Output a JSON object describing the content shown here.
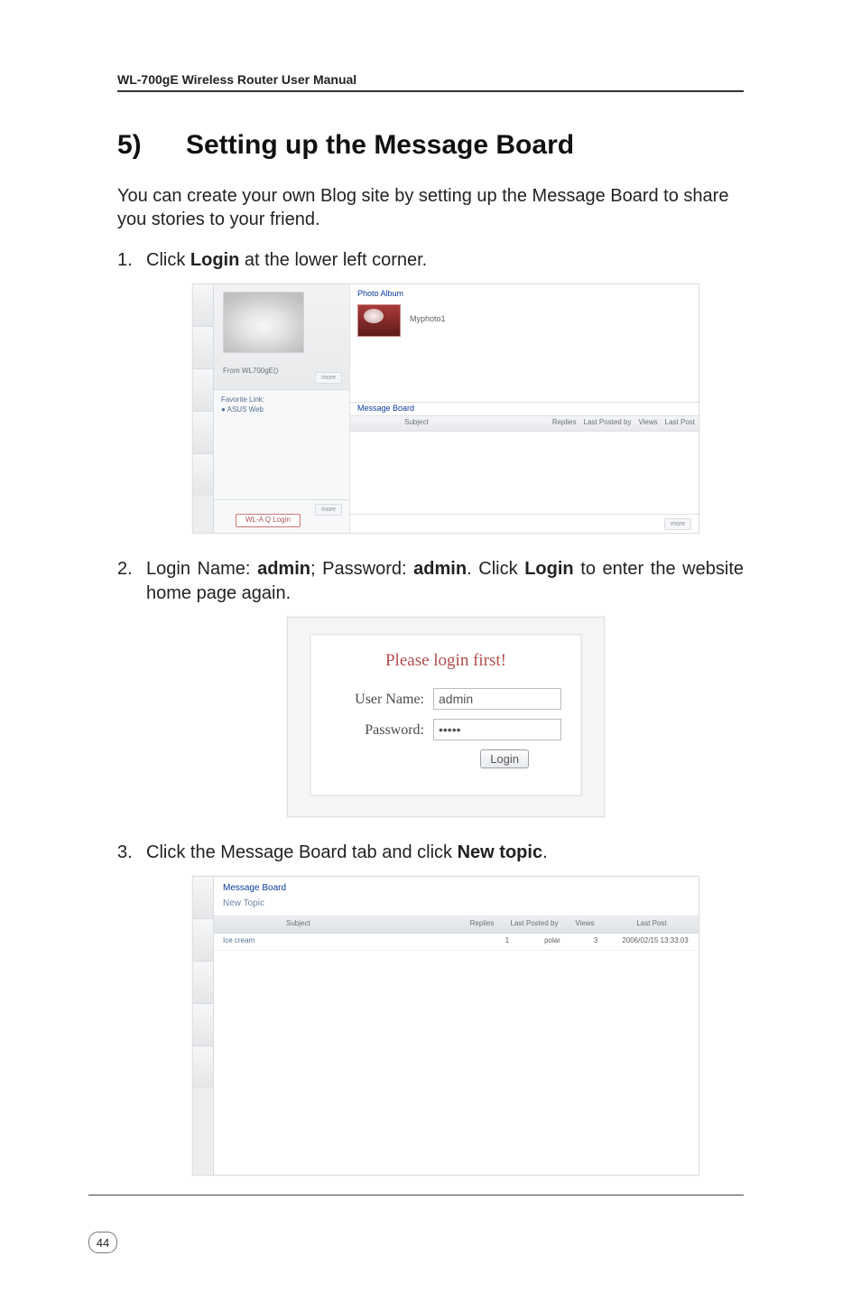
{
  "doc": {
    "running_head": "WL-700gE Wireless Router User Manual",
    "section_number": "5)",
    "section_title": "Setting up the Message Board",
    "intro": "You can create your own Blog site by setting up the Message Board to share you stories to your friend.",
    "page_number": "44"
  },
  "steps": {
    "s1_marker": "1.",
    "s1_a": "Click ",
    "s1_b": "Login",
    "s1_c": " at the lower left corner.",
    "s2_marker": "2.",
    "s2_a": "Login Name: ",
    "s2_b": "admin",
    "s2_c": "; Password: ",
    "s2_d": "admin",
    "s2_e": ". Click ",
    "s2_f": "Login",
    "s2_g": " to enter the website home page again.",
    "s3_marker": "3.",
    "s3_a": "Click the Message Board tab and click ",
    "s3_b": "New topic",
    "s3_c": "."
  },
  "fig1": {
    "album_meta": "From   WL700gE()",
    "more": "more",
    "favorite1": "Favorite Link:",
    "favorite2": "● ASUS Web",
    "login_btn": "WL-A Q Login",
    "photo_album_title": "Photo Album",
    "photo_label": "Myphoto1",
    "msg_board_title": "Message Board",
    "th_subject": "Subject",
    "th_replies": "Replies",
    "th_lastposted": "Last Posted by",
    "th_views": "Views",
    "th_lastpost": "Last Post"
  },
  "fig2": {
    "title": "Please login first!",
    "username_label": "User Name:",
    "username_value": "admin",
    "password_label": "Password:",
    "password_value": "•••••",
    "button": "Login"
  },
  "fig3": {
    "title": "Message Board",
    "new_topic": "New Topic",
    "th_subject": "Subject",
    "th_replies": "Replies",
    "th_lastposted": "Last Posted by",
    "th_views": "Views",
    "th_lastpost": "Last Post",
    "row": {
      "subject": "Ice cream",
      "replies": "1",
      "lastposted": "polar",
      "views": "3",
      "lastpost": "2006/02/15 13:33:03"
    }
  }
}
